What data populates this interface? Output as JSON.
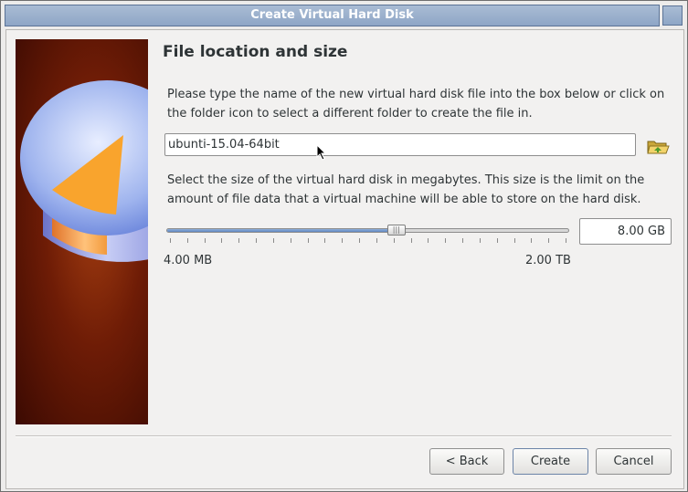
{
  "window": {
    "title": "Create Virtual Hard Disk"
  },
  "page": {
    "title": "File location and size",
    "location_description": "Please type the name of the new virtual hard disk file into the box below or click on the folder icon to select a different folder to create the file in.",
    "size_description": "Select the size of the virtual hard disk in megabytes. This size is the limit on the amount of file data that a virtual machine will be able to store on the hard disk."
  },
  "location": {
    "value": "ubunti-15.04-64bit",
    "folder_icon": "folder-open-icon"
  },
  "size": {
    "value": "8.00 GB",
    "min_label": "4.00 MB",
    "max_label": "2.00 TB",
    "slider_fraction": 0.571
  },
  "buttons": {
    "back": "< Back",
    "create": "Create",
    "cancel": "Cancel"
  },
  "colors": {
    "accent": "#8ea6c6",
    "slider_fill": "#6b8fc6",
    "banner": "#6e1c06"
  }
}
